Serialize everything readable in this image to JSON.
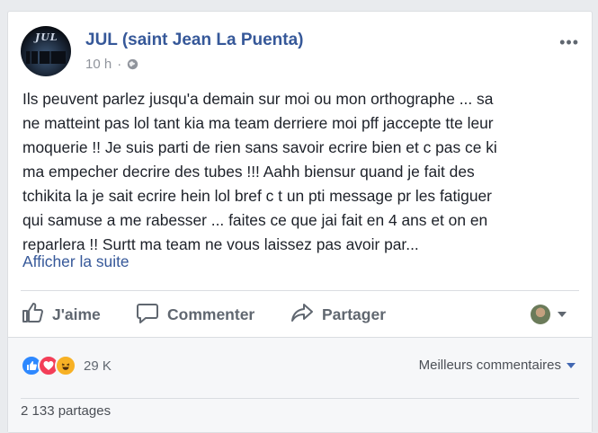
{
  "post": {
    "page_name": "JUL (saint Jean La Puenta)",
    "time": "10 h",
    "time_separator": "·",
    "more_icon": "•••",
    "avatar_logo_text": "JUL",
    "text_lines": [
      "Ils peuvent parlez jusqu'a demain sur moi ou mon orthographe ... sa",
      "ne matteint pas lol tant kia ma team derriere moi pff jaccepte tte leur",
      "moquerie !! Je suis parti de rien sans savoir ecrire bien et c pas ce ki",
      "ma empecher decrire des tubes !!! Aahh biensur quand je fait des",
      "tchikita la je sait ecrire hein lol bref c t un pti message pr les fatiguer",
      "qui samuse a me rabesser ... faites ce que jai fait en 4 ans et on en",
      "reparlera !! Surtt ma team ne vous laissez pas avoir par..."
    ],
    "see_more": "Afficher la suite"
  },
  "actions": {
    "like": "J'aime",
    "comment": "Commenter",
    "share": "Partager"
  },
  "footer": {
    "reactions_count": "29 K",
    "sort_label": "Meilleurs commentaires",
    "shares": "2 133 partages"
  },
  "colors": {
    "link": "#365899",
    "like_reaction": "#2d88ff",
    "love_reaction": "#f33e58",
    "haha_reaction": "#f7b125"
  },
  "icons": [
    "globe-icon",
    "more-options-icon",
    "like-icon",
    "comment-icon",
    "share-icon",
    "chevron-down-icon"
  ]
}
